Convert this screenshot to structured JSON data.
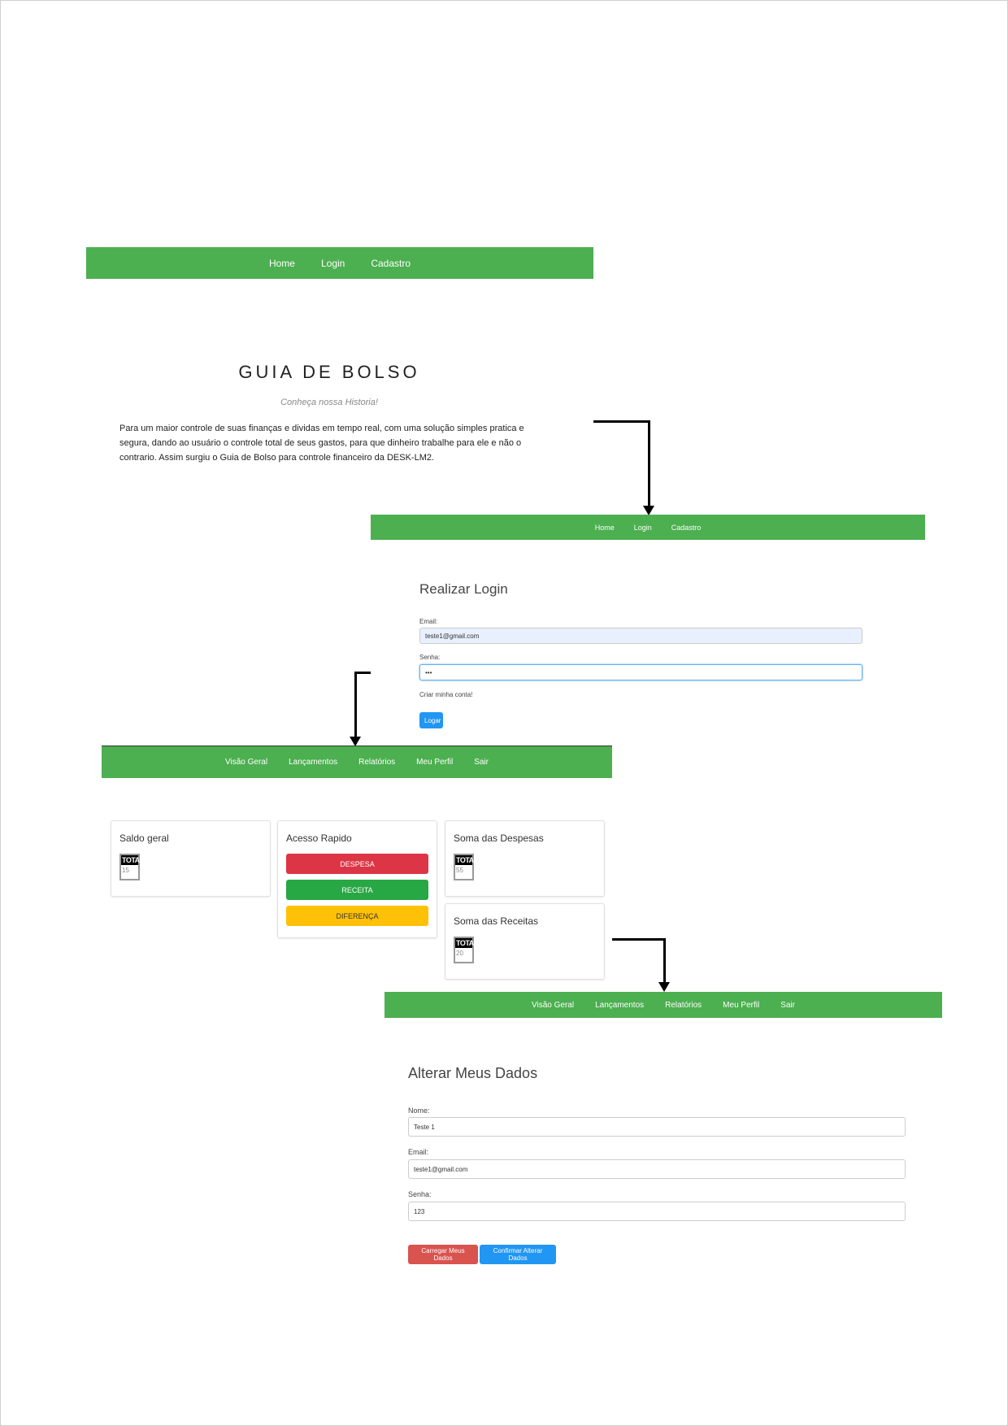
{
  "public_nav": {
    "home": "Home",
    "login": "Login",
    "cadastro": "Cadastro"
  },
  "home": {
    "title": "GUIA DE BOLSO",
    "subtitle": "Conheça nossa Historia!",
    "intro": "Para um maior controle de suas finanças e dividas em tempo real, com uma solução simples pratica e segura, dando ao usuário o controle total de seus gastos, para que dinheiro trabalhe para ele e não o contrario. Assim surgiu o Guia de Bolso para controle financeiro da DESK-LM2."
  },
  "login": {
    "heading": "Realizar Login",
    "email_label": "Email:",
    "email_value": "teste1@gmail.com",
    "password_label": "Senha:",
    "password_value": "•••",
    "create_account": "Criar minha conta!",
    "submit": "Logar"
  },
  "app_nav": {
    "overview": "Visão Geral",
    "entries": "Lançamentos",
    "reports": "Relatórios",
    "profile": "Meu Perfil",
    "logout": "Sair"
  },
  "dashboard": {
    "balance": {
      "title": "Saldo geral",
      "total_label": "TOTAL",
      "value": "15"
    },
    "quick": {
      "title": "Acesso Rapido",
      "expense": "DESPESA",
      "income": "RECEITA",
      "difference": "DIFERENÇA"
    },
    "expenses": {
      "title": "Soma das Despesas",
      "total_label": "TOTAL",
      "value": "55"
    },
    "incomes": {
      "title": "Soma das Receitas",
      "total_label": "TOTAL",
      "value": "20"
    }
  },
  "profile": {
    "heading": "Alterar Meus Dados",
    "name_label": "Nome:",
    "name_value": "Teste 1",
    "email_label": "Email:",
    "email_value": "teste1@gmail.com",
    "password_label": "Senha:",
    "password_value": "123",
    "load_button": "Carregar Meus Dados",
    "confirm_button": "Confirmar Alterar Dados"
  },
  "colors": {
    "nav_green": "#4caf50",
    "primary_blue": "#2196f3",
    "danger_red": "#dc3545",
    "success_green": "#28a745",
    "warning_yellow": "#ffc107"
  }
}
